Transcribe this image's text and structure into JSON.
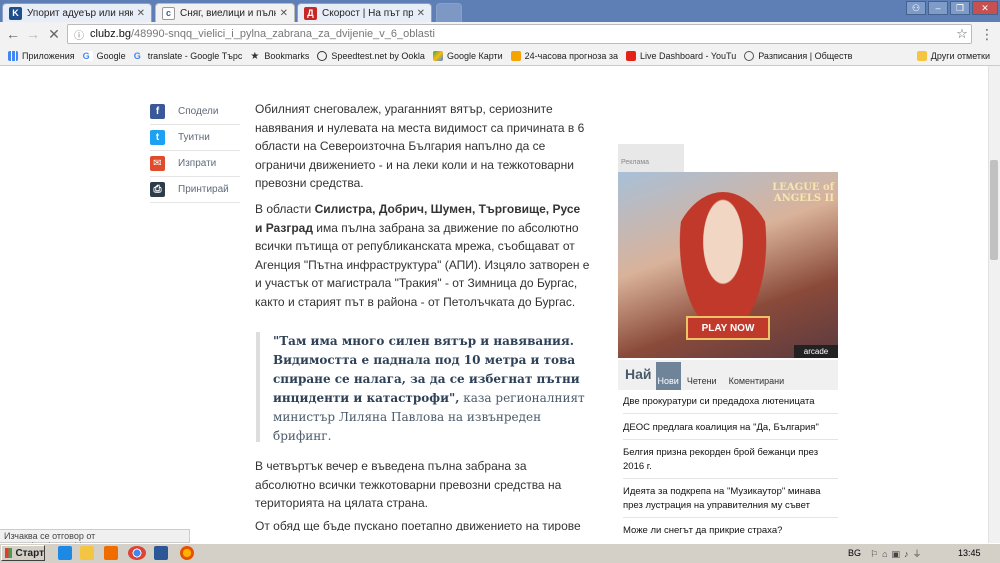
{
  "browser": {
    "tabs": [
      {
        "favicon": "K",
        "title": "Упорит адуеър или някакъ"
      },
      {
        "favicon": "c",
        "title": "Сняг, виелици и пълна за"
      },
      {
        "favicon": "Д",
        "title": "Скорост | На път през зи"
      }
    ],
    "url_domain": "clubz.bg",
    "url_path": "/48990-snqq_vielici_i_pylna_zabrana_za_dvijenie_v_6_oblasti",
    "bookmarks": [
      "Приложения",
      "Google",
      "translate - Google Търс",
      "Bookmarks",
      "Speedtest.net by Ookla",
      "Google Карти",
      "24-часова прогноза за",
      "Live Dashboard - YouTu",
      "Разписания | Обществ"
    ],
    "other_bookmarks": "Други отметки",
    "colors": {
      "tabbar": "#5d7fb5",
      "facebook": "#3b5998",
      "twitter": "#1da1f2",
      "mail": "#e04b2b",
      "print": "#2d3b4a"
    }
  },
  "share": [
    {
      "icon": "facebook-icon",
      "glyph": "f",
      "label": "Сподели"
    },
    {
      "icon": "twitter-icon",
      "glyph": "t",
      "label": "Туитни"
    },
    {
      "icon": "mail-icon",
      "glyph": "✉",
      "label": "Изпрати"
    },
    {
      "icon": "print-icon",
      "glyph": "⎙",
      "label": "Принтирай"
    }
  ],
  "article": {
    "p1": "Обилният снеговалеж, ураганният вятър, сериозните навявания и нулевата на места видимост са причината в 6 области на Североизточна България напълно да се ограничи движението - и на леки коли и на тежкотоварни превозни средства.",
    "p2_pre": "В области ",
    "p2_bold": "Силистра, Добрич, Шумен, Търговище, Русе и Разград",
    "p2_post": " има пълна забрана за движение по абсолютно всички пътища от републиканската мрежа, съобщават от Агенция \"Пътна инфраструктура\" (АПИ). Изцяло затворен е и участък от магистрала \"Тракия\" - от Зимница до Бургас, както и старият път в района - от Петолъчката до Бургас.",
    "quote_bold": "\"Там има много силен вятър и навявания. Видимостта е паднала под 10 метра и това спиране се налага, за да се избегнат пътни инциденти и катастрофи\",",
    "quote_tail": " каза регионалният министър Лиляна Павлова на извънреден брифинг.",
    "p3": "В четвъртък вечер е въведена пълна забрана за абсолютно всички тежкотоварни превозни средства на територията на цялата страна.",
    "p4": "От обяд ще бъде пускано поетапно движението на тирове"
  },
  "sidebar": {
    "ad_label": "Реклама",
    "ad_brand": "LEAGUE of ANGELS II",
    "ad_cta": "PLAY NOW",
    "ad_vendor": "arcade",
    "tabs_title": "Най",
    "tabs": [
      "Нови",
      "Четени",
      "Коментирани"
    ],
    "news": [
      "Две прокуратури си предадоха лютеницата",
      "ДЕОС предлага коалиция на \"Да, България\"",
      "Белгия призна рекорден брой бежанци през 2016 г.",
      "Идеята за подкрепа на \"Музикаутор\" минава през лустрация на управителния му съвет",
      "Може ли снегът да прикрие страха?"
    ]
  },
  "status": "Изчаква се отговор от post.advertiseworld.com...",
  "taskbar": {
    "start": "Старт",
    "lang": "BG",
    "clock": "13:45"
  }
}
